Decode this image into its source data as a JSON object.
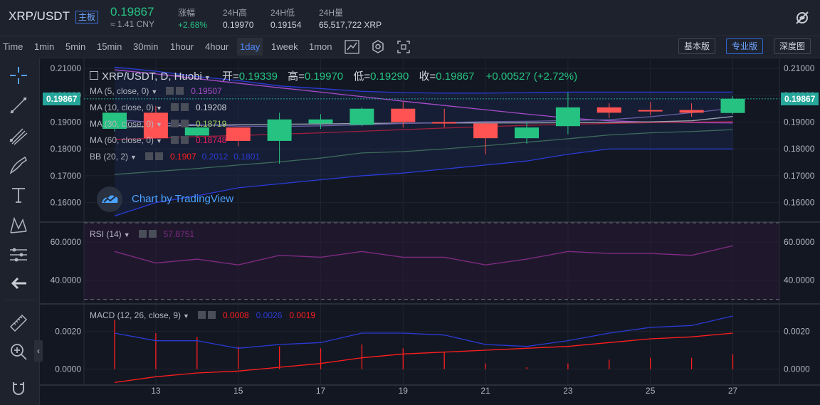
{
  "header": {
    "pair": "XRP/USDT",
    "board_badge": "主板",
    "last_price": "0.19867",
    "cny_price": "≈ 1.41 CNY",
    "stats": [
      {
        "label": "涨幅",
        "value": "+2.68%",
        "color": "#26c281"
      },
      {
        "label": "24H高",
        "value": "0.19970",
        "color": "#d1d4dc"
      },
      {
        "label": "24H低",
        "value": "0.19154",
        "color": "#d1d4dc"
      },
      {
        "label": "24H量",
        "value": "65,517,722 XRP",
        "color": "#d1d4dc"
      }
    ]
  },
  "toolbar": {
    "timeframes": [
      "Time",
      "1min",
      "5min",
      "15min",
      "30min",
      "1hour",
      "4hour",
      "1day",
      "1week",
      "1mon"
    ],
    "active_timeframe": "1day",
    "views": [
      "基本版",
      "专业版",
      "深度图"
    ],
    "active_view": "专业版"
  },
  "legend": {
    "symbol_line": "XRP/USDT, D, Huobi",
    "open_label": "开=",
    "open": "0.19339",
    "high_label": "高=",
    "high": "0.19970",
    "low_label": "低=",
    "low": "0.19290",
    "close_label": "收=",
    "close": "0.19867",
    "change": "+0.00527 (+2.72%)",
    "indicators": [
      {
        "name": "MA (5, close, 0)",
        "value": "0.19507",
        "color": "#a64cc9"
      },
      {
        "name": "MA (10, close, 0)",
        "value": "0.19208",
        "color": "#d1d4dc"
      },
      {
        "name": "MA (30, close, 0)",
        "value": "0.18719",
        "color": "#9ccc65"
      },
      {
        "name": "MA (60, close, 0)",
        "value": "0.18748",
        "color": "#e91e63"
      }
    ],
    "bb": {
      "name": "BB (20, 2)",
      "values": [
        "0.1907",
        "0.2012",
        "0.1801"
      ],
      "colors": [
        "#ff1e1e",
        "#2a3bd6",
        "#2a3bd6"
      ]
    },
    "rsi": {
      "name": "RSI (14)",
      "value": "57.8751"
    },
    "macd": {
      "name": "MACD (12, 26, close, 9)",
      "values": [
        "0.0008",
        "0.0026",
        "0.0019"
      ],
      "colors": [
        "#ff1e1e",
        "#2a3bd6",
        "#ff1e1e"
      ]
    }
  },
  "watermark": "Chart by TradingView",
  "price_axis": {
    "ticks": [
      "0.21000",
      "0.20000",
      "0.19000",
      "0.18000",
      "0.17000",
      "0.16000"
    ],
    "current": "0.19867"
  },
  "rsi_axis": {
    "ticks": [
      "60.0000",
      "40.0000"
    ]
  },
  "macd_axis": {
    "ticks": [
      "0.0020",
      "0.0000"
    ]
  },
  "time_axis": {
    "ticks": [
      "13",
      "15",
      "17",
      "19",
      "21",
      "23",
      "25",
      "27"
    ]
  },
  "chart_data": {
    "type": "candlestick",
    "x": [
      12,
      13,
      14,
      15,
      16,
      17,
      18,
      19,
      20,
      21,
      22,
      23,
      24,
      25,
      26,
      27
    ],
    "ohlc": [
      [
        0.1875,
        0.1915,
        0.1865,
        0.1935
      ],
      [
        0.1935,
        0.196,
        0.184,
        0.184
      ],
      [
        0.185,
        0.188,
        0.1845,
        0.188
      ],
      [
        0.188,
        0.188,
        0.181,
        0.183
      ],
      [
        0.183,
        0.1935,
        0.1745,
        0.191
      ],
      [
        0.1895,
        0.193,
        0.1875,
        0.191
      ],
      [
        0.189,
        0.1955,
        0.1885,
        0.195
      ],
      [
        0.195,
        0.1975,
        0.188,
        0.19
      ],
      [
        0.19,
        0.195,
        0.188,
        0.1895
      ],
      [
        0.1895,
        0.19,
        0.178,
        0.184
      ],
      [
        0.184,
        0.19,
        0.182,
        0.188
      ],
      [
        0.1885,
        0.201,
        0.1855,
        0.1955
      ],
      [
        0.1955,
        0.197,
        0.1915,
        0.1935
      ],
      [
        0.1945,
        0.1975,
        0.1925,
        0.194
      ],
      [
        0.1945,
        0.197,
        0.192,
        0.1935
      ],
      [
        0.1934,
        0.1997,
        0.1929,
        0.1987
      ]
    ],
    "ma5": [
      0.191,
      0.1898,
      0.189,
      0.1885,
      0.1884,
      0.1886,
      0.189,
      0.1895,
      0.1898,
      0.1902,
      0.1903,
      0.1906,
      0.1909,
      0.192,
      0.1935,
      0.1951
    ],
    "bb_upper": [
      0.2105,
      0.209,
      0.207,
      0.2055,
      0.2035,
      0.2025,
      0.2015,
      0.201,
      0.2008,
      0.2008,
      0.201,
      0.2012,
      0.2012,
      0.2012,
      0.2012,
      0.2012
    ],
    "bb_mid": [
      0.1705,
      0.1716,
      0.1727,
      0.174,
      0.1752,
      0.1766,
      0.1785,
      0.179,
      0.18,
      0.1812,
      0.1825,
      0.1838,
      0.1852,
      0.186,
      0.1865,
      0.1872
    ],
    "bb_lower": [
      0.155,
      0.16,
      0.1625,
      0.1655,
      0.167,
      0.1685,
      0.17,
      0.171,
      0.1725,
      0.174,
      0.1755,
      0.178,
      0.18,
      0.18,
      0.18,
      0.18
    ],
    "ma_purple": [
      0.2095,
      0.208,
      0.2062,
      0.2045,
      0.2028,
      0.2012,
      0.1995,
      0.1978,
      0.1962,
      0.1946,
      0.193,
      0.1915,
      0.1905,
      0.19,
      0.1898,
      0.1897
    ],
    "ma_red": [
      0.1835,
      0.184,
      0.1846,
      0.185,
      0.1855,
      0.186,
      0.1866,
      0.1872,
      0.1878,
      0.1883,
      0.1888,
      0.1892,
      0.1895,
      0.1898,
      0.19,
      0.1902
    ],
    "ma_grey": [
      0.188,
      0.1885,
      0.1888,
      0.189,
      0.1892,
      0.1893,
      0.1895,
      0.1896,
      0.1897,
      0.1897,
      0.1897,
      0.1898,
      0.1899,
      0.1901,
      0.1905,
      0.1921
    ],
    "price_range": [
      0.153,
      0.2135
    ],
    "rsi": [
      55,
      49,
      51,
      48,
      53,
      52,
      55,
      52,
      52,
      48,
      51,
      55,
      54,
      54,
      53,
      58
    ],
    "rsi_range": [
      28,
      70
    ],
    "rsi_bands": [
      70,
      30
    ],
    "macd": [
      0.0019,
      0.0015,
      0.0015,
      0.0011,
      0.0013,
      0.0014,
      0.0019,
      0.0019,
      0.0018,
      0.0013,
      0.0012,
      0.0015,
      0.0019,
      0.0022,
      0.0023,
      0.0028
    ],
    "signal": [
      -0.0007,
      -0.0004,
      -0.0002,
      -0.0001,
      0.0001,
      0.0003,
      0.0006,
      0.0008,
      0.0009,
      0.001,
      0.0011,
      0.0012,
      0.0014,
      0.0016,
      0.0017,
      0.0019
    ],
    "histogram": [
      0.0026,
      0.0019,
      0.0017,
      0.0012,
      0.0012,
      0.0011,
      0.0013,
      0.0011,
      0.0009,
      0.0003,
      0.0001,
      0.0003,
      0.0005,
      0.0006,
      0.0006,
      0.0008
    ],
    "macd_range": [
      -0.0008,
      0.0034
    ],
    "colors": {
      "up": "#26c281",
      "down": "#ff5252",
      "bb": "#2a3bd6",
      "ma5": "#a64cc9",
      "ma_grey": "#9ca3b0",
      "ma_green": "#3e6b5c",
      "rsi": "#7e2a80",
      "macd": "#2a3bd6",
      "signal": "#ff1e1e",
      "hist": "#ff1e1e"
    }
  }
}
